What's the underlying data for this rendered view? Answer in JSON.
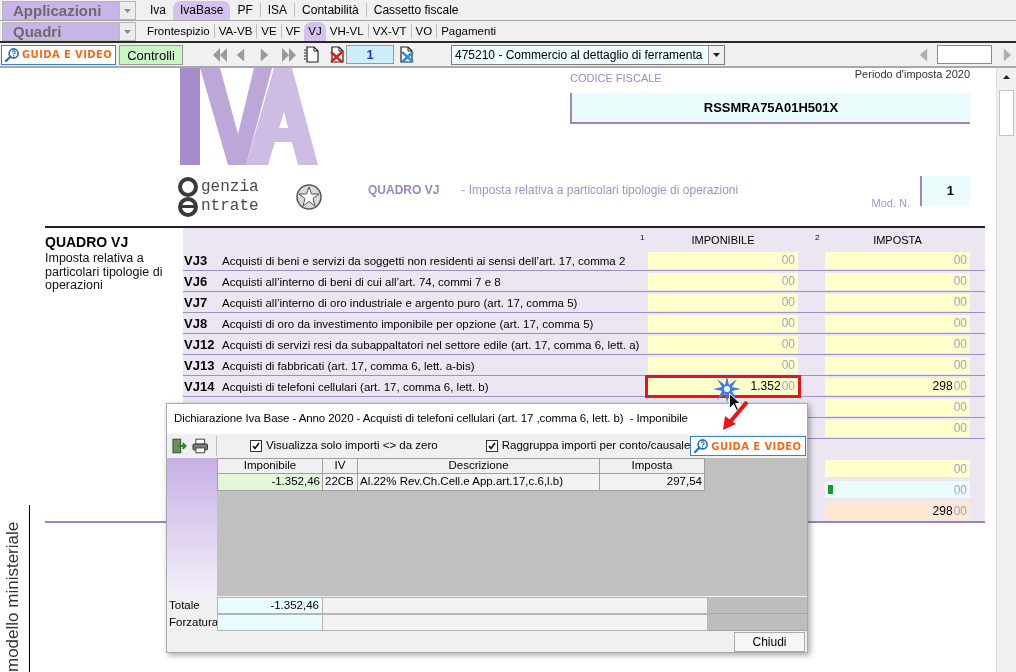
{
  "app_menu": {
    "applications": "Applicazioni",
    "sections": "Quadri"
  },
  "module_tabs": [
    {
      "label": "Iva",
      "selected": false
    },
    {
      "label": "IvaBase",
      "selected": true
    },
    {
      "label": "PF",
      "selected": false
    },
    {
      "label": "ISA",
      "selected": false
    },
    {
      "label": "Contabilità",
      "selected": false
    },
    {
      "label": "Cassetto fiscale",
      "selected": false
    }
  ],
  "section_tabs": [
    {
      "label": "Frontespizio",
      "selected": false
    },
    {
      "label": "VA-VB",
      "selected": false
    },
    {
      "label": "VE",
      "selected": false
    },
    {
      "label": "VF",
      "selected": false
    },
    {
      "label": "VJ",
      "selected": true
    },
    {
      "label": "VH-VL",
      "selected": false
    },
    {
      "label": "VX-VT",
      "selected": false
    },
    {
      "label": "VO",
      "selected": false
    },
    {
      "label": "Pagamenti",
      "selected": false
    }
  ],
  "toolbar": {
    "guide_button": "GUIDA E VIDEO",
    "check_button": "Controlli",
    "page_number": "1",
    "activity": "475210 - Commercio al dettaglio di ferramenta"
  },
  "form": {
    "period": "Periodo d'imposta 2020",
    "tax_code_label": "CODICE FISCALE",
    "tax_code": "RSSMRA75A01H501X",
    "agency_logo": {
      "line_1": "genzia",
      "line_2": "ntrate"
    },
    "heading": {
      "title": "QUADRO VJ",
      "subtitle": "- Imposta relativa a particolari tipologie di operazioni"
    },
    "module_label": "Mod. N.",
    "module_number": "1",
    "section": {
      "title": "QUADRO VJ",
      "description": "Imposta relativa a particolari tipologie di operazioni"
    },
    "columns": [
      {
        "number": "1",
        "label": "IMPONIBILE"
      },
      {
        "number": "2",
        "label": "IMPOSTA"
      }
    ],
    "rows": [
      {
        "code": "VJ3",
        "description": "Acquisti di beni e servizi da soggetti non residenti ai sensi dell’art. 17, comma 2",
        "imponibile": {
          "decimals": "00",
          "highlighted": false
        },
        "imposta": {
          "decimals": "00"
        }
      },
      {
        "code": "VJ6",
        "description": "Acquisti all’interno di beni di cui all’art. 74, commi 7 e 8",
        "imponibile": {
          "decimals": "00",
          "highlighted": false
        },
        "imposta": {
          "decimals": "00"
        }
      },
      {
        "code": "VJ7",
        "description": "Acquisti all’interno di oro industriale e argento puro (art. 17, comma 5)",
        "imponibile": {
          "decimals": "00",
          "highlighted": false
        },
        "imposta": {
          "decimals": "00"
        }
      },
      {
        "code": "VJ8",
        "description": "Acquisti di oro da investimento imponibile per opzione (art. 17, comma 5)",
        "imponibile": {
          "decimals": "00",
          "highlighted": false
        },
        "imposta": {
          "decimals": "00"
        }
      },
      {
        "code": "VJ12",
        "description": "Acquisti di servizi resi da subappaltatori nel settore edile (art. 17, comma 6, lett. a)",
        "imponibile": {
          "decimals": "00",
          "highlighted": false
        },
        "imposta": {
          "decimals": "00"
        }
      },
      {
        "code": "VJ13",
        "description": "Acquisti di fabbricati (art. 17, comma 6, lett. a-bis)",
        "imponibile": {
          "decimals": "00",
          "highlighted": false
        },
        "imposta": {
          "decimals": "00"
        }
      },
      {
        "code": "VJ14",
        "description": "Acquisti di telefoni cellulari (art. 17, comma 6, lett. b)",
        "imponibile": {
          "value": "1.352",
          "decimals": "00",
          "highlighted": true
        },
        "imposta": {
          "value": "298",
          "decimals": "00"
        }
      },
      {
        "imposta": {
          "decimals": "00"
        }
      },
      {
        "imposta": {
          "decimals": "00"
        }
      }
    ],
    "summary": [
      {
        "kind": "input",
        "imposta": {
          "decimals": "00",
          "flag": false
        }
      },
      {
        "kind": "computed",
        "imposta": {
          "decimals": "00",
          "flag": true
        }
      },
      {
        "kind": "total",
        "imposta": {
          "value": "298",
          "decimals": "00",
          "flag": false
        }
      }
    ],
    "side_label": "modello ministeriale"
  },
  "dialog": {
    "title": "Dichiarazione Iva Base - Anno 2020 - Acquisti di telefoni cellulari (art. 17 ,comma 6, lett. b)  - Imponibile",
    "options": [
      {
        "label": "Visualizza solo importi <> da zero",
        "checked": true
      },
      {
        "label": "Raggruppa importi per conto/causale",
        "checked": true
      }
    ],
    "guide_button": "GUIDA E VIDEO",
    "table": {
      "columns": [
        "Imponibile",
        "IV",
        "Descrizione",
        "Imposta"
      ],
      "rows": [
        [
          "-1.352,46",
          "22CB",
          "Al.22% Rev.Ch.Cell.e App.art.17,c.6,l.b)",
          "297,54"
        ]
      ]
    },
    "totals": [
      {
        "label": "Totale",
        "value": "-1.352,46"
      },
      {
        "label": "Forzatura"
      }
    ],
    "close_button": "Chiudi"
  }
}
